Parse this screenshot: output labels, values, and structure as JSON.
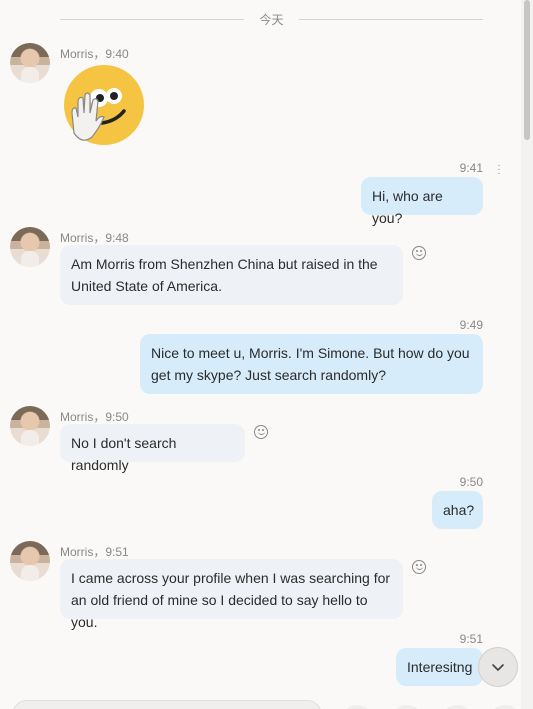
{
  "date_separator": "今天",
  "messages": [
    {
      "sender": "Morris",
      "time": "Morris，9:40",
      "type": "sticker",
      "sticker": "waving-hand-emoji"
    },
    {
      "direction": "out",
      "time": "9:41",
      "text": "Hi, who are you?"
    },
    {
      "sender": "Morris",
      "time": "Morris，9:48",
      "text_line1": "Am Morris from Shenzhen China but raised in the",
      "text_line2": "United State of America."
    },
    {
      "direction": "out",
      "time": "9:49",
      "text_line1": "Nice to meet u, Morris. I'm Simone. But how do you",
      "text_line2": "get my skype? Just search randomly?"
    },
    {
      "sender": "Morris",
      "time": "Morris，9:50",
      "text": "No I don't search randomly"
    },
    {
      "direction": "out",
      "time": "9:50",
      "text": "aha?"
    },
    {
      "sender": "Morris",
      "time": "Morris，9:51",
      "text_line1": "I came across your profile when I was searching for",
      "text_line2": "an old friend of mine so I decided to say hello to you."
    },
    {
      "direction": "out",
      "time": "9:51",
      "text": "Interesitng"
    }
  ],
  "icons": {
    "react": "smile-icon",
    "more": "more-vertical-icon",
    "scroll_down": "chevron-down-icon"
  },
  "colors": {
    "incoming_bubble": "#eef2f6",
    "outgoing_bubble": "#d6ecfb",
    "background": "#faf9f8"
  }
}
